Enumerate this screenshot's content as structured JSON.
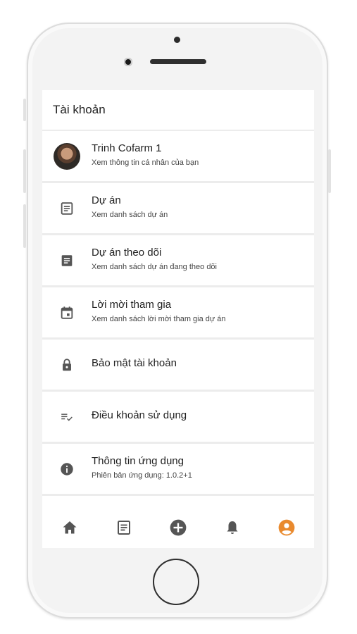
{
  "header": {
    "title": "Tài khoản"
  },
  "items": [
    {
      "icon": "avatar",
      "title": "Trinh Cofarm 1",
      "subtitle": "Xem thông tin cá nhân của bạn"
    },
    {
      "icon": "article-outline-icon",
      "title": "Dự án",
      "subtitle": "Xem danh sách dự án"
    },
    {
      "icon": "article-filled-icon",
      "title": "Dự án theo dõi",
      "subtitle": "Xem danh sách dự án đang theo dõi"
    },
    {
      "icon": "calendar-icon",
      "title": "Lời mời tham gia",
      "subtitle": "Xem danh sách lời mời tham gia dự án"
    },
    {
      "icon": "lock-icon",
      "title": "Bảo mật tài khoản",
      "subtitle": ""
    },
    {
      "icon": "rule-icon",
      "title": "Điều khoản sử dụng",
      "subtitle": ""
    },
    {
      "icon": "info-icon",
      "title": "Thông tin ứng dụng",
      "subtitle": "Phiên bản ứng dụng: 1.0.2+1"
    }
  ],
  "bottom_nav": [
    {
      "icon": "home-icon",
      "active": false
    },
    {
      "icon": "projects-icon",
      "active": false
    },
    {
      "icon": "add-circle-icon",
      "active": false
    },
    {
      "icon": "bell-icon",
      "active": false
    },
    {
      "icon": "account-icon",
      "active": true
    }
  ],
  "colors": {
    "icon": "#555555",
    "active": "#e98a2e",
    "text": "#222222"
  }
}
